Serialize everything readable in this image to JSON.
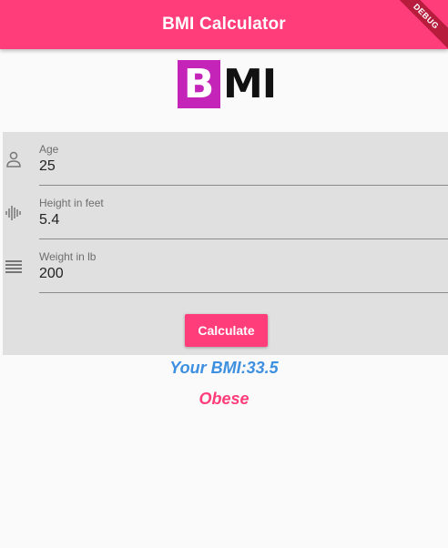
{
  "app_bar": {
    "title": "BMI Calculator",
    "debug_banner": "DEBUG",
    "color": "#ff3d7a"
  },
  "logo": {
    "letter_b": "B",
    "letters_mi": "MI",
    "b_background": "#c424b8"
  },
  "form": {
    "fields": [
      {
        "label": "Age",
        "value": "25",
        "icon": "person-icon"
      },
      {
        "label": "Height in feet",
        "value": "5.4",
        "icon": "height-waveform-icon"
      },
      {
        "label": "Weight in lb",
        "value": "200",
        "icon": "weight-lines-icon"
      }
    ],
    "calculate_label": "Calculate"
  },
  "result": {
    "bmi_text": "Your BMI:33.5",
    "status_text": "Obese",
    "bmi_color": "#3d8fe0",
    "status_color": "#ff3d7a"
  }
}
